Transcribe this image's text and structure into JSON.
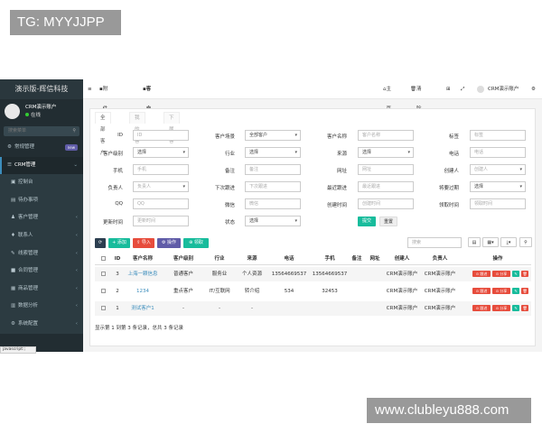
{
  "watermarks": {
    "top": "TG: MYYJJPP",
    "bottom": "www.clubleyu888.com"
  },
  "sidebar": {
    "brand": "演示版-辉信科技",
    "user_name": "CRM演示账户",
    "user_status": "在线",
    "search_placeholder": "搜索菜单",
    "items": [
      {
        "label": "常规管理",
        "badge": "new",
        "icon": "gear-icon"
      },
      {
        "label": "CRM管理",
        "icon": "list-icon"
      },
      {
        "label": "控制台",
        "icon": "dashboard-icon"
      },
      {
        "label": "待办事项",
        "icon": "todo-icon"
      },
      {
        "label": "客户管理",
        "icon": "users-icon"
      },
      {
        "label": "联系人",
        "icon": "contact-icon"
      },
      {
        "label": "线索管理",
        "icon": "lead-icon"
      },
      {
        "label": "合同管理",
        "icon": "contract-icon"
      },
      {
        "label": "商品管理",
        "icon": "product-icon"
      },
      {
        "label": "数据分析",
        "icon": "chart-icon"
      },
      {
        "label": "系统配置",
        "icon": "config-icon"
      }
    ]
  },
  "topbar": {
    "tab1": "附件管理",
    "tab2": "客户列表",
    "home": "主页",
    "clear_cache": "清除缓存",
    "user": "CRM演示账户"
  },
  "content": {
    "tabs": [
      "全部客户",
      "我的客户",
      "下属客户"
    ],
    "form": {
      "id_label": "ID",
      "id_placeholder": "ID",
      "scene_label": "客户场景",
      "scene_value": "全部客户",
      "name_label": "客户名称",
      "name_placeholder": "客户名称",
      "tag_label": "标签",
      "tag_placeholder": "标签",
      "level_label": "客户级别",
      "level_value": "选择",
      "industry_label": "行业",
      "industry_value": "选择",
      "source_label": "来源",
      "source_value": "选择",
      "phone_label": "电话",
      "phone_placeholder": "电话",
      "mobile_label": "手机",
      "mobile_placeholder": "手机",
      "remark_label": "备注",
      "remark_placeholder": "备注",
      "site_label": "网址",
      "site_placeholder": "网址",
      "creator_label": "创建人",
      "creator_value": "创建人",
      "owner_label": "负责人",
      "owner_value": "负责人",
      "next_label": "下次跟进",
      "next_placeholder": "下次跟进",
      "last_label": "最近跟进",
      "last_placeholder": "最近跟进",
      "expire_label": "将要过期",
      "expire_value": "选择",
      "qq_label": "QQ",
      "qq_placeholder": "QQ",
      "wechat_label": "微信",
      "wechat_placeholder": "微信",
      "created_label": "创建时间",
      "created_placeholder": "创建时间",
      "claim_label": "领取时间",
      "claim_placeholder": "领取时间",
      "updated_label": "更新时间",
      "updated_placeholder": "更新时间",
      "status_label": "状态",
      "status_value": "选择",
      "submit": "提交",
      "reset": "重置"
    },
    "toolbar": {
      "add": "添加",
      "import": "导入",
      "operate": "操作",
      "claim": "领取",
      "search_placeholder": "搜索"
    },
    "table": {
      "headers": [
        "ID",
        "客户名称",
        "客户级别",
        "行业",
        "来源",
        "电话",
        "手机",
        "备注",
        "网址",
        "创建人",
        "负责人",
        "操作"
      ],
      "rows": [
        {
          "id": "3",
          "name": "上海一颗信息",
          "level": "普通客户",
          "industry": "服务业",
          "source": "个人资源",
          "phone": "13564669537",
          "mobile": "13564669537",
          "remark": "",
          "site": "",
          "creator": "CRM演示账户",
          "owner": "CRM演示账户"
        },
        {
          "id": "2",
          "name": "1234",
          "level": "重点客户",
          "industry": "IT/互联网",
          "source": "转介绍",
          "phone": "534",
          "mobile": "32453",
          "remark": "",
          "site": "",
          "creator": "CRM演示账户",
          "owner": "CRM演示账户"
        },
        {
          "id": "1",
          "name": "测试客户1",
          "level": "-",
          "industry": "-",
          "source": "-",
          "phone": "",
          "mobile": "",
          "remark": "",
          "site": "",
          "creator": "CRM演示账户",
          "owner": "CRM演示账户"
        }
      ],
      "action_follow": "跟进",
      "action_share": "分享"
    },
    "footer": "显示第 1 到第 3 条记录，总共 3 条记录"
  },
  "status_url": "javascript:;",
  "colors": {
    "sidebar": "#222d32",
    "primary": "#3c8dbc",
    "green": "#18bc9c",
    "red": "#e74c3c",
    "purple": "#605ca8",
    "dark": "#2c3e50"
  }
}
